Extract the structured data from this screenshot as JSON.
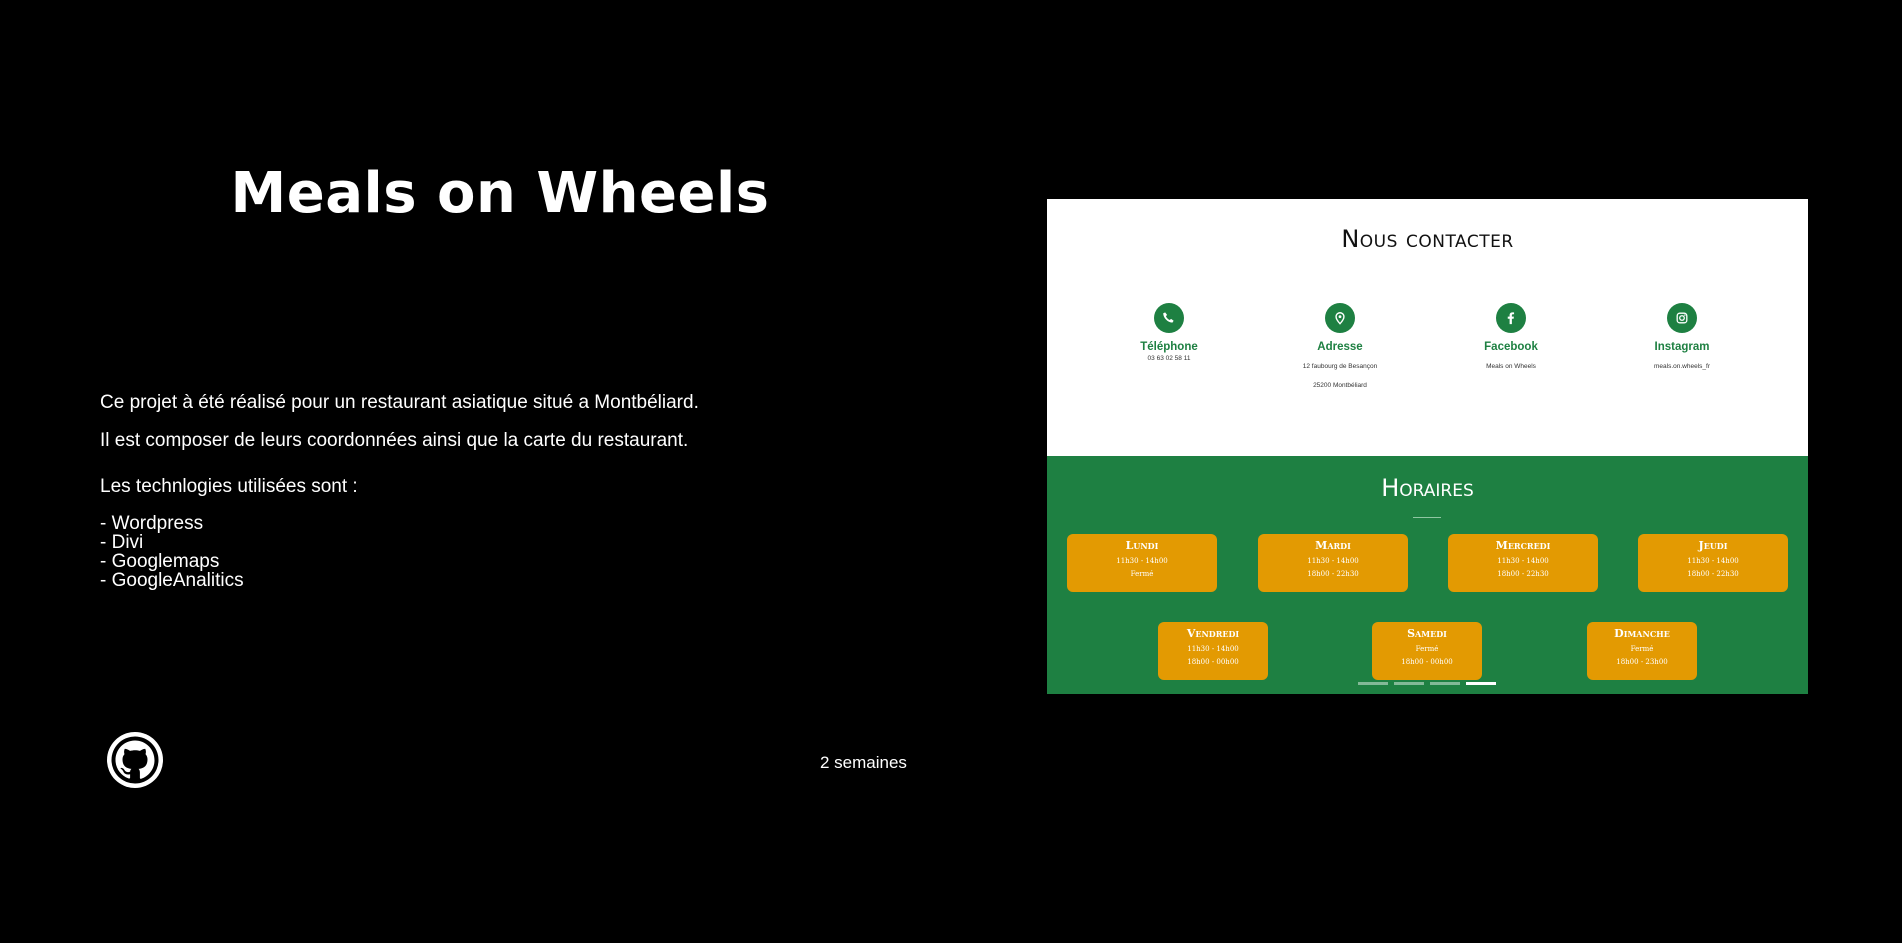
{
  "project": {
    "title": "Meals on Wheels",
    "description_lines": [
      "Ce projet à été réalisé pour un restaurant asiatique situé a Montbéliard.",
      "Il est composer de leurs coordonnées ainsi que la carte du restaurant."
    ],
    "tech_heading": "Les technlogies utilisées sont :",
    "technologies": [
      "- Wordpress",
      "- Divi",
      "- Googlemaps",
      "- GoogleAnalitics"
    ],
    "duration": "2 semaines",
    "github_icon": "github-icon"
  },
  "preview": {
    "contact": {
      "title": "Nous contacter",
      "items": [
        {
          "icon": "phone-icon",
          "label": "Téléphone",
          "value": "03 63 02 58 11",
          "value2": ""
        },
        {
          "icon": "map-pin-icon",
          "label": "Adresse",
          "value": "12 faubourg de Besançon",
          "value2": "25200 Montbéliard"
        },
        {
          "icon": "facebook-icon",
          "label": "Facebook",
          "value": "Meals on Wheels",
          "value2": ""
        },
        {
          "icon": "instagram-icon",
          "label": "Instagram",
          "value": "meals.on.wheels_fr",
          "value2": ""
        }
      ],
      "accent_color": "#1e8042"
    },
    "hours": {
      "title": "Horaires",
      "days": [
        {
          "name": "Lundi",
          "line1": "11h30 - 14h00",
          "line2": "Fermé"
        },
        {
          "name": "Mardi",
          "line1": "11h30 - 14h00",
          "line2": "18h00 - 22h30"
        },
        {
          "name": "Mercredi",
          "line1": "11h30 - 14h00",
          "line2": "18h00 - 22h30"
        },
        {
          "name": "Jeudi",
          "line1": "11h30 - 14h00",
          "line2": "18h00 - 22h30"
        },
        {
          "name": "Vendredi",
          "line1": "11h30 - 14h00",
          "line2": "18h00 - 00h00"
        },
        {
          "name": "Samedi",
          "line1": "Fermé",
          "line2": "18h00 - 00h00"
        },
        {
          "name": "Dimanche",
          "line1": "Fermé",
          "line2": "18h00 - 23h00"
        }
      ],
      "background_color": "#1e8042",
      "card_color": "#e39a02",
      "active_slide": 4,
      "slide_count": 4
    }
  }
}
